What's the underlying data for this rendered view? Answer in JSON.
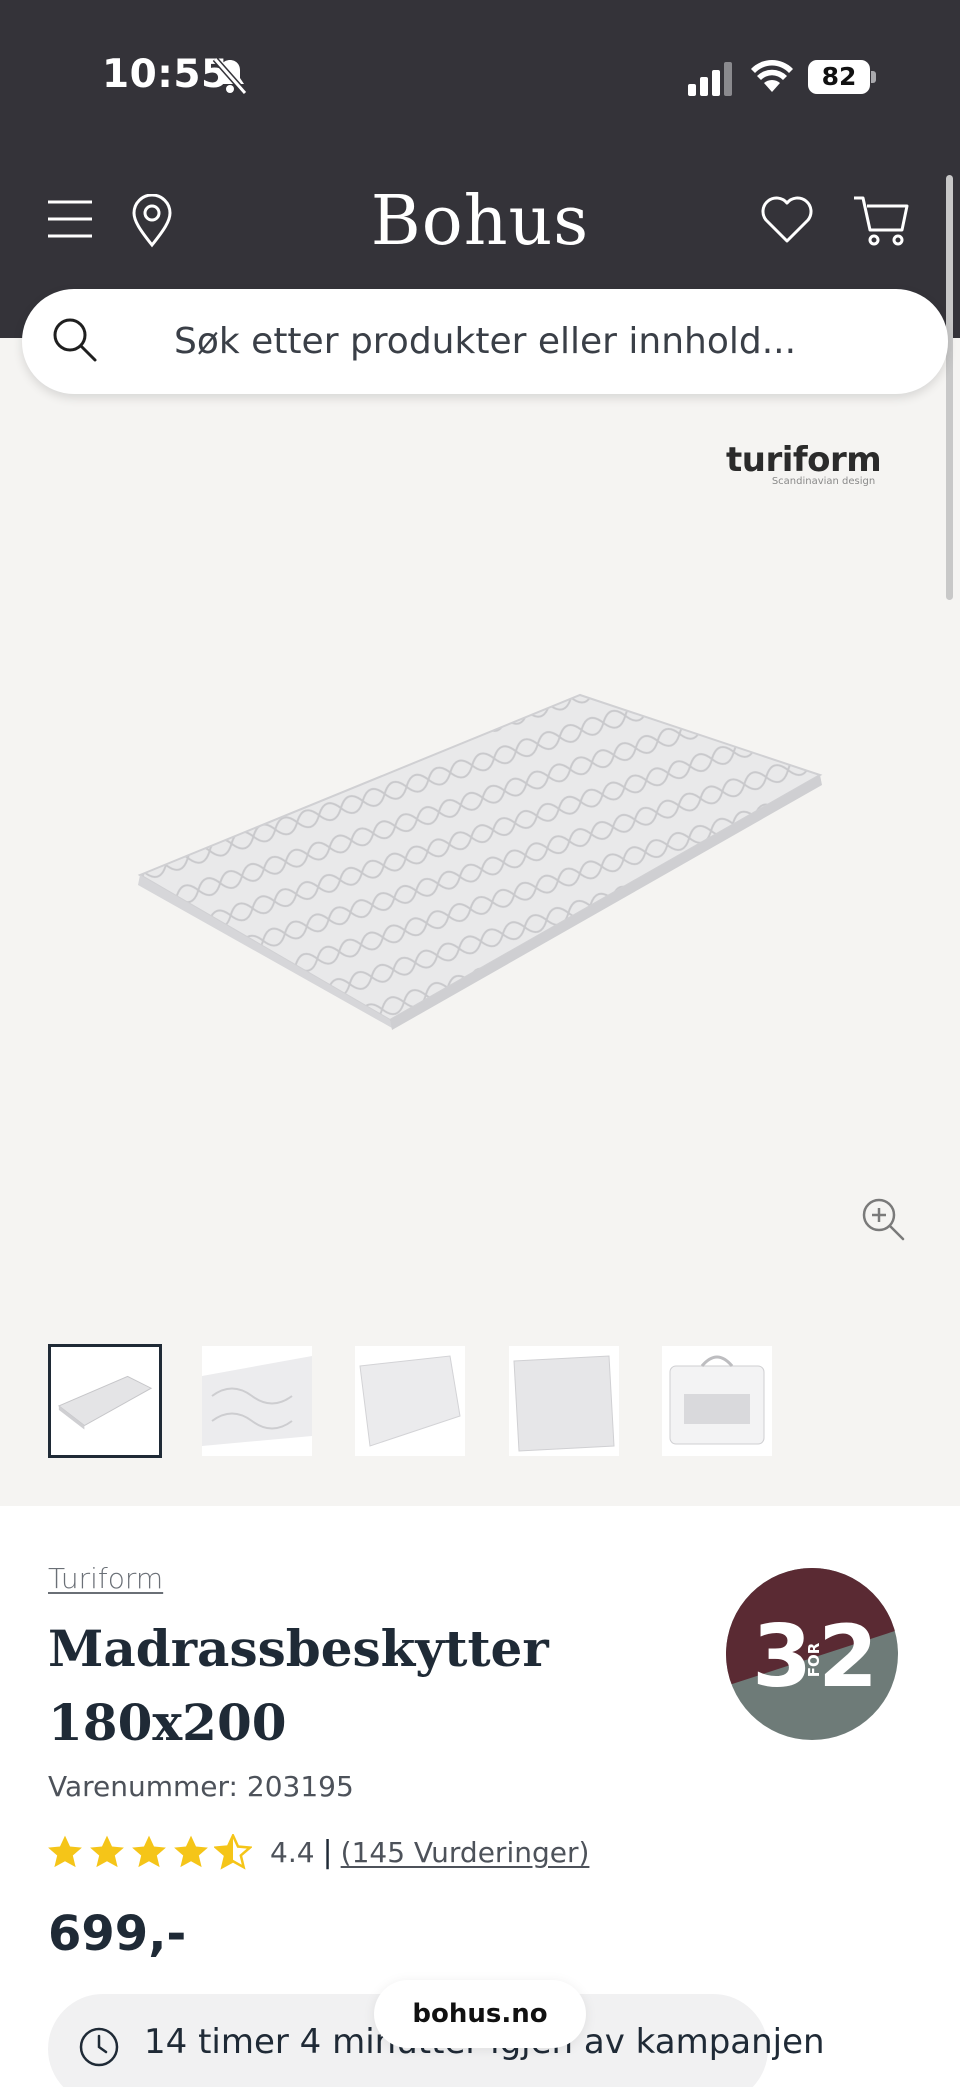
{
  "status_bar": {
    "time": "10:55",
    "battery": "82"
  },
  "header": {
    "logo": "Bohus"
  },
  "search": {
    "placeholder": "Søk etter produkter eller innhold..."
  },
  "gallery": {
    "brand_logo_text": "turiform",
    "brand_logo_tagline": "Scandinavian design",
    "thumbnail_count": 5,
    "active_thumbnail": 1
  },
  "product": {
    "brand": "Turiform",
    "title": "Madrassbeskytter 180x200",
    "sku": "Varenummer: 203195",
    "rating": "4.4",
    "rating_stars": 4.5,
    "rating_separator": "|",
    "reviews": "(145 Vurderinger)",
    "price": "699,-",
    "badge": {
      "big": "3",
      "small": "FOR",
      "big2": "2",
      "color_top": "#5a2a33",
      "color_bottom": "#6e7b78"
    }
  },
  "campaign": {
    "timer_text": "14 timer 4 minutter igjen av kampanjen"
  },
  "browser": {
    "url": "bohus.no"
  },
  "colors": {
    "topbar": "#343339",
    "gallery_bg": "#f5f4f2",
    "star": "#f5c518",
    "text": "#1f2a36"
  }
}
